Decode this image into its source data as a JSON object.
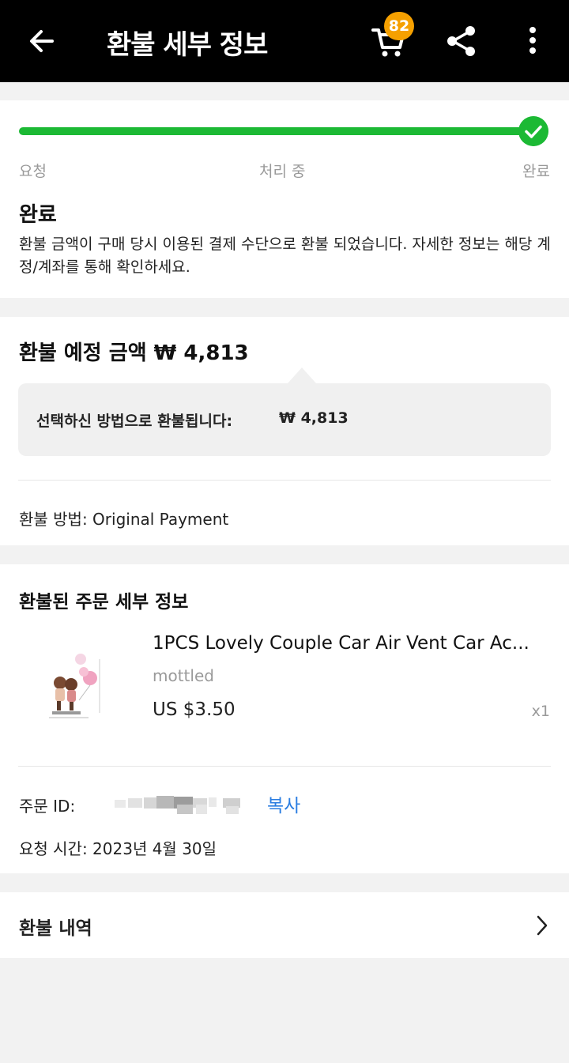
{
  "header": {
    "title": "환불 세부 정보",
    "cart_count": "82",
    "icons": [
      "back-arrow-icon",
      "cart-icon",
      "share-icon",
      "more-vertical-icon"
    ]
  },
  "status": {
    "progress_fraction": 1.0,
    "steps": [
      "요청",
      "처리 중",
      "완료"
    ],
    "title": "완료",
    "description": "환불 금액이 구매 당시 이용된 결제 수단으로 환불 되었습니다. 자세한 정보는 해당 계정/계좌를 통해 확인하세요."
  },
  "refund": {
    "title": "환불 예정 금액 ₩ 4,813",
    "method_label": "선택하신 방법으로 환불됩니다:",
    "method_amount": "₩ 4,813",
    "payment_method": "환불 방법: Original Payment"
  },
  "order": {
    "title": "환불된 주문 세부 정보",
    "product_name": "1PCS Lovely Couple Car Air Vent Car Ac...",
    "variant": "mottled",
    "price": "US $3.50",
    "quantity": "x1",
    "order_id_label": "주문 ID:",
    "copy_label": "복사",
    "request_time": "요청 시간: 2023년 4월 30일"
  },
  "history": {
    "label": "환불 내역"
  },
  "colors": {
    "accent_green": "#1cb934",
    "badge_orange": "#f5a000",
    "link_blue": "#2a7de1"
  }
}
